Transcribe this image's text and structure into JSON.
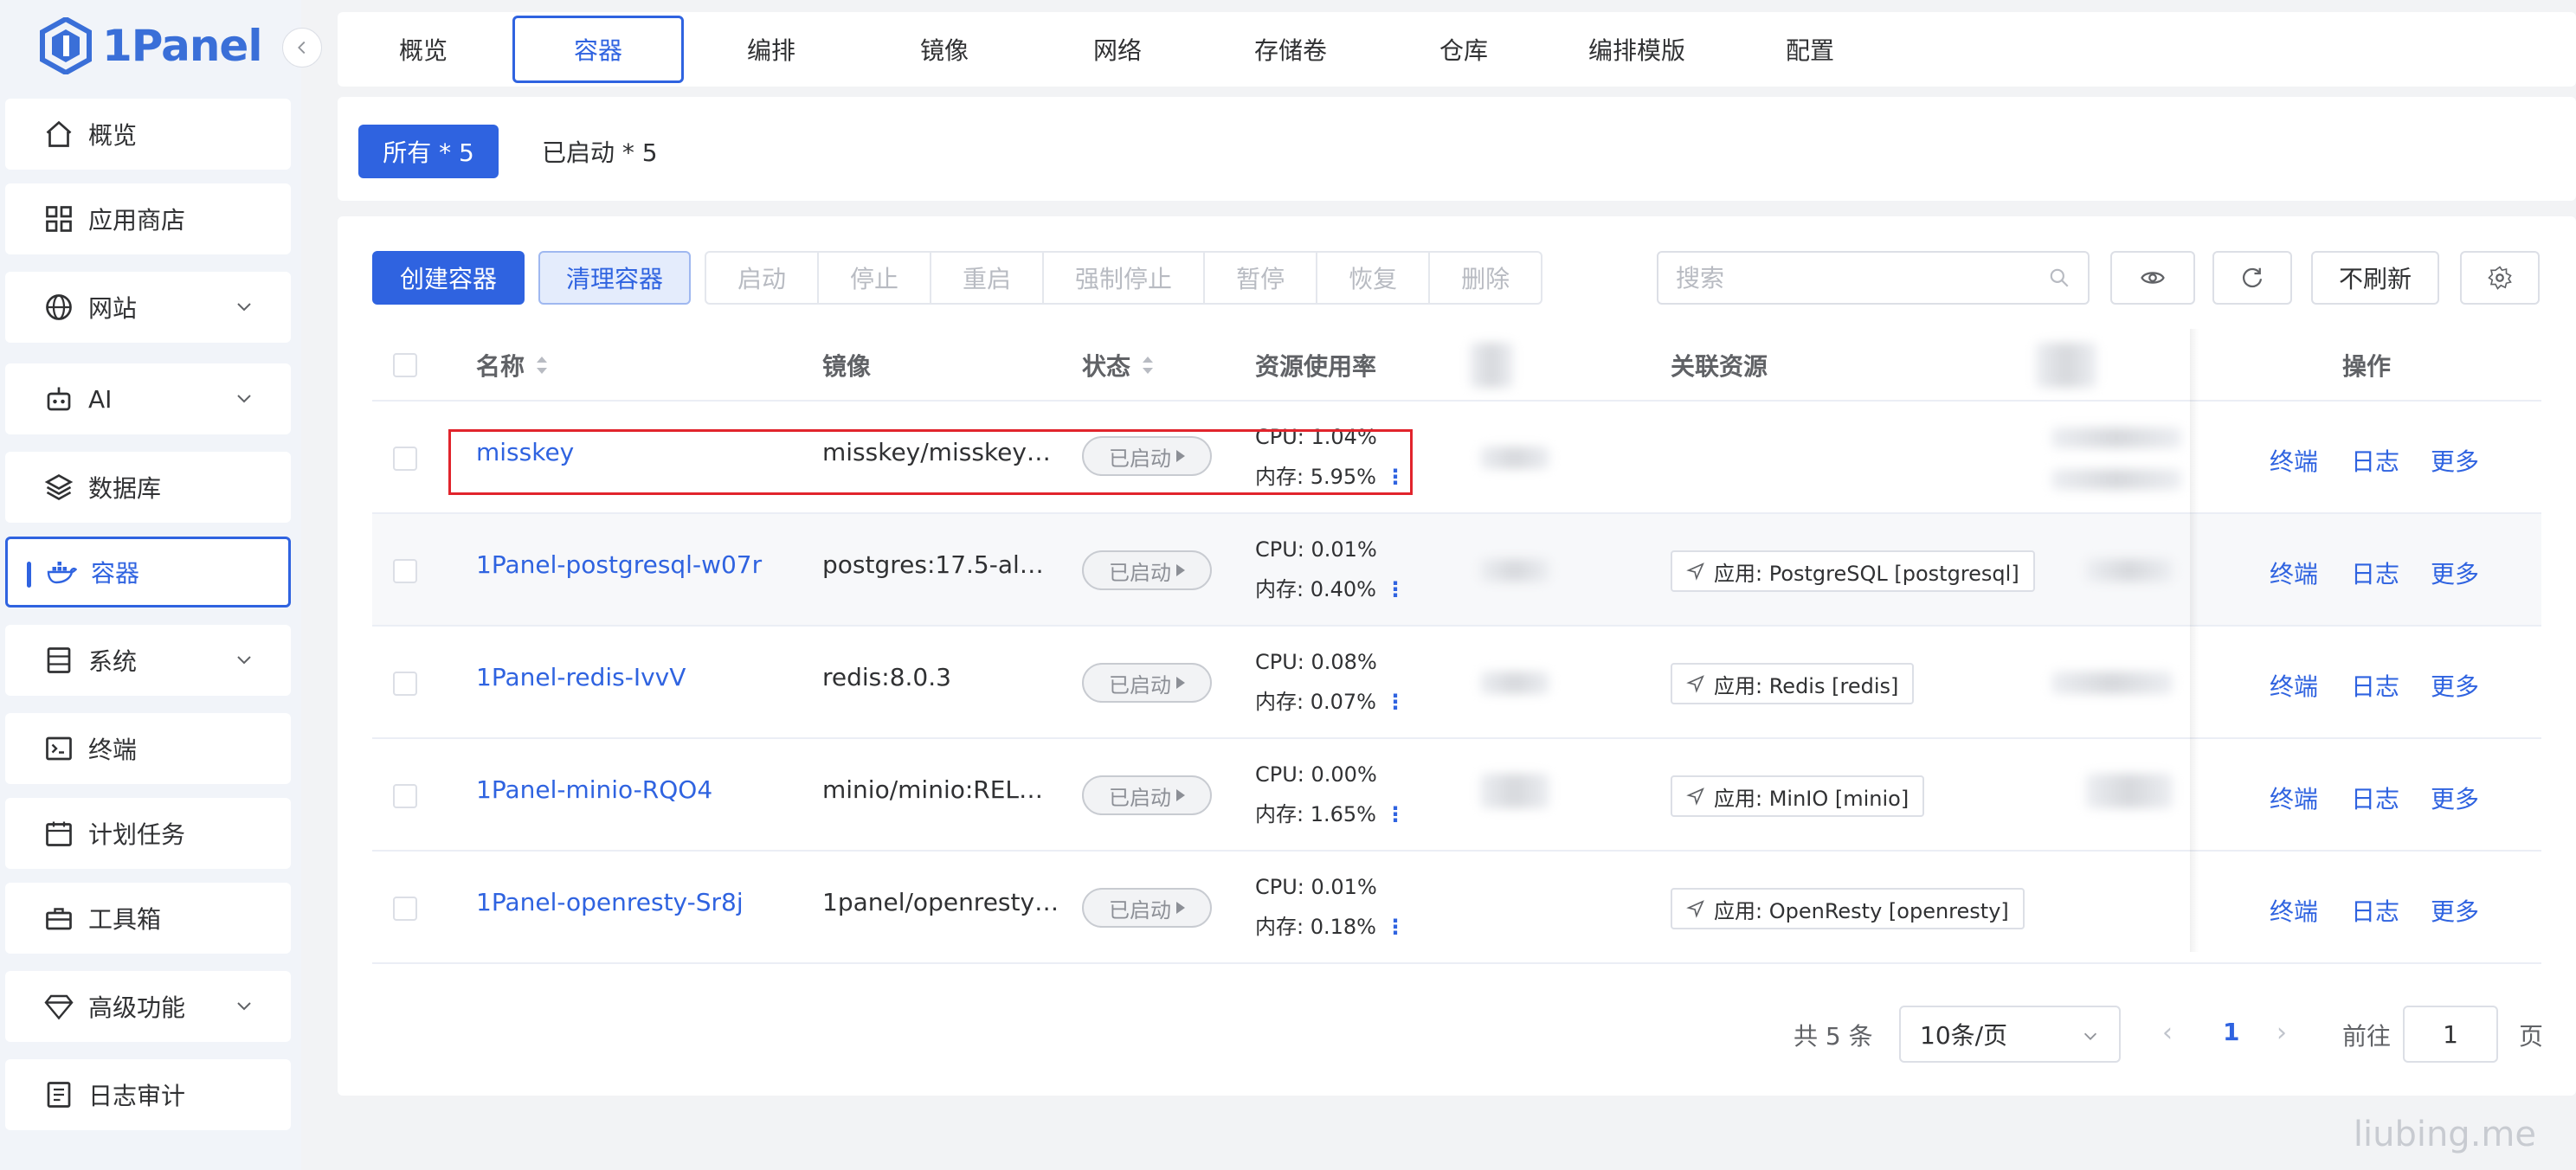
{
  "app": {
    "name": "1Panel",
    "accent": "#2f63e0"
  },
  "sidebar": {
    "items": [
      {
        "label": "概览",
        "icon": "home-icon"
      },
      {
        "label": "应用商店",
        "icon": "apps-grid-icon"
      },
      {
        "label": "网站",
        "icon": "globe-icon",
        "expandable": true
      },
      {
        "label": "AI",
        "icon": "robot-icon",
        "expandable": true
      },
      {
        "label": "数据库",
        "icon": "layers-icon"
      },
      {
        "label": "容器",
        "icon": "docker-icon",
        "active": true
      },
      {
        "label": "系统",
        "icon": "server-icon",
        "expandable": true
      },
      {
        "label": "终端",
        "icon": "terminal-icon"
      },
      {
        "label": "计划任务",
        "icon": "calendar-icon"
      },
      {
        "label": "工具箱",
        "icon": "toolbox-icon"
      },
      {
        "label": "高级功能",
        "icon": "diamond-icon",
        "expandable": true
      },
      {
        "label": "日志审计",
        "icon": "log-icon"
      }
    ]
  },
  "tabs": [
    "概览",
    "容器",
    "编排",
    "镜像",
    "网络",
    "存储卷",
    "仓库",
    "编排模版",
    "配置"
  ],
  "active_tab": "容器",
  "filters": {
    "all": "所有 * 5",
    "running": "已启动 * 5"
  },
  "toolbar": {
    "create": "创建容器",
    "clean": "清理容器",
    "actions": [
      "启动",
      "停止",
      "重启",
      "强制停止",
      "暂停",
      "恢复",
      "删除"
    ],
    "search_placeholder": "搜索",
    "no_refresh": "不刷新"
  },
  "table": {
    "headers": {
      "name": "名称",
      "image": "镜像",
      "status": "状态",
      "usage": "资源使用率",
      "related": "关联资源",
      "ops": "操作"
    },
    "rows": [
      {
        "name": "misskey",
        "image": "misskey/misskey…",
        "status": "已启动",
        "cpu": "CPU: 1.04%",
        "mem": "内存: 5.95%",
        "related": ""
      },
      {
        "name": "1Panel-postgresql-w07r",
        "image": "postgres:17.5-al…",
        "status": "已启动",
        "cpu": "CPU: 0.01%",
        "mem": "内存: 0.40%",
        "related": "应用: PostgreSQL [postgresql]"
      },
      {
        "name": "1Panel-redis-IvvV",
        "image": "redis:8.0.3",
        "status": "已启动",
        "cpu": "CPU: 0.08%",
        "mem": "内存: 0.07%",
        "related": "应用: Redis [redis]"
      },
      {
        "name": "1Panel-minio-RQO4",
        "image": "minio/minio:REL…",
        "status": "已启动",
        "cpu": "CPU: 0.00%",
        "mem": "内存: 1.65%",
        "related": "应用: MinIO [minio]"
      },
      {
        "name": "1Panel-openresty-Sr8j",
        "image": "1panel/openresty…",
        "status": "已启动",
        "cpu": "CPU: 0.01%",
        "mem": "内存: 0.18%",
        "related": "应用: OpenResty [openresty]"
      }
    ],
    "row_ops": [
      "终端",
      "日志",
      "更多"
    ]
  },
  "pagination": {
    "total": "共 5 条",
    "page_size": "10条/页",
    "current": "1",
    "goto_label": "前往",
    "goto_value": "1",
    "page_suffix": "页"
  },
  "watermark": "liubing.me"
}
